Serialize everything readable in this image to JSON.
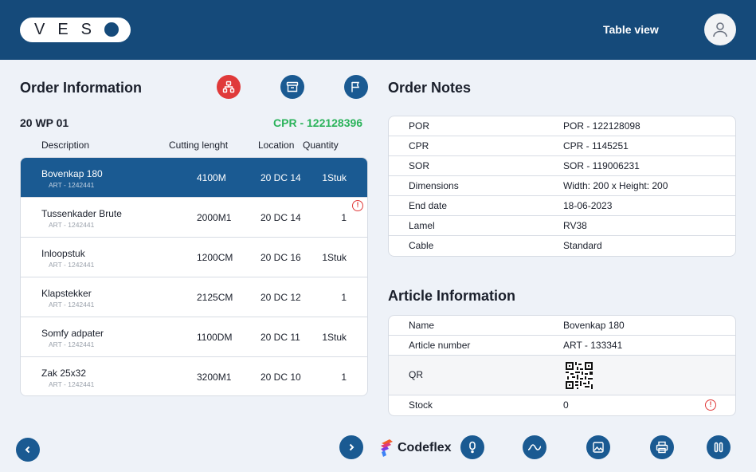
{
  "header": {
    "logo_text": "VES",
    "table_view_label": "Table view"
  },
  "order_info": {
    "title": "Order Information",
    "wp_code": "20 WP 01",
    "cpr_code": "CPR - 122128396",
    "columns": {
      "description": "Description",
      "cutting": "Cutting lenght",
      "location": "Location",
      "quantity": "Quantity"
    },
    "rows": [
      {
        "desc": "Bovenkap 180",
        "art": "ART - 1242441",
        "len": "4100M",
        "loc": "20 DC 14",
        "qty": "1Stuk"
      },
      {
        "desc": "Tussenkader Brute",
        "art": "ART - 1242441",
        "len": "2000M1",
        "loc": "20 DC 14",
        "qty": "1"
      },
      {
        "desc": "Inloopstuk",
        "art": "ART - 1242441",
        "len": "1200CM",
        "loc": "20 DC 16",
        "qty": "1Stuk"
      },
      {
        "desc": "Klapstekker",
        "art": "ART - 1242441",
        "len": "2125CM",
        "loc": "20 DC 12",
        "qty": "1"
      },
      {
        "desc": "Somfy adpater",
        "art": "ART - 1242441",
        "len": "1100DM",
        "loc": "20 DC 11",
        "qty": "1Stuk"
      },
      {
        "desc": "Zak 25x32",
        "art": "ART - 1242441",
        "len": "3200M1",
        "loc": "20 DC 10",
        "qty": "1"
      }
    ],
    "warning_glyph": "!"
  },
  "order_notes": {
    "title": "Order Notes",
    "rows": [
      {
        "k": "POR",
        "v": "POR - 122128098"
      },
      {
        "k": "CPR",
        "v": "CPR - 1145251"
      },
      {
        "k": "SOR",
        "v": "SOR - 119006231"
      },
      {
        "k": "Dimensions",
        "v": "Width: 200 x Height: 200"
      },
      {
        "k": "End date",
        "v": "18-06-2023"
      },
      {
        "k": "Lamel",
        "v": "RV38"
      },
      {
        "k": "Cable",
        "v": "Standard"
      }
    ]
  },
  "article_info": {
    "title": "Article Information",
    "name_label": "Name",
    "name_value": "Bovenkap 180",
    "number_label": "Article number",
    "number_value": "ART - 133341",
    "qr_label": "QR",
    "stock_label": "Stock",
    "stock_value": "0"
  },
  "brand": {
    "name": "Codeflex"
  },
  "colors": {
    "header": "#154a7a",
    "accent": "#1a5a92",
    "success": "#2bb35b",
    "danger": "#e03a3a"
  }
}
